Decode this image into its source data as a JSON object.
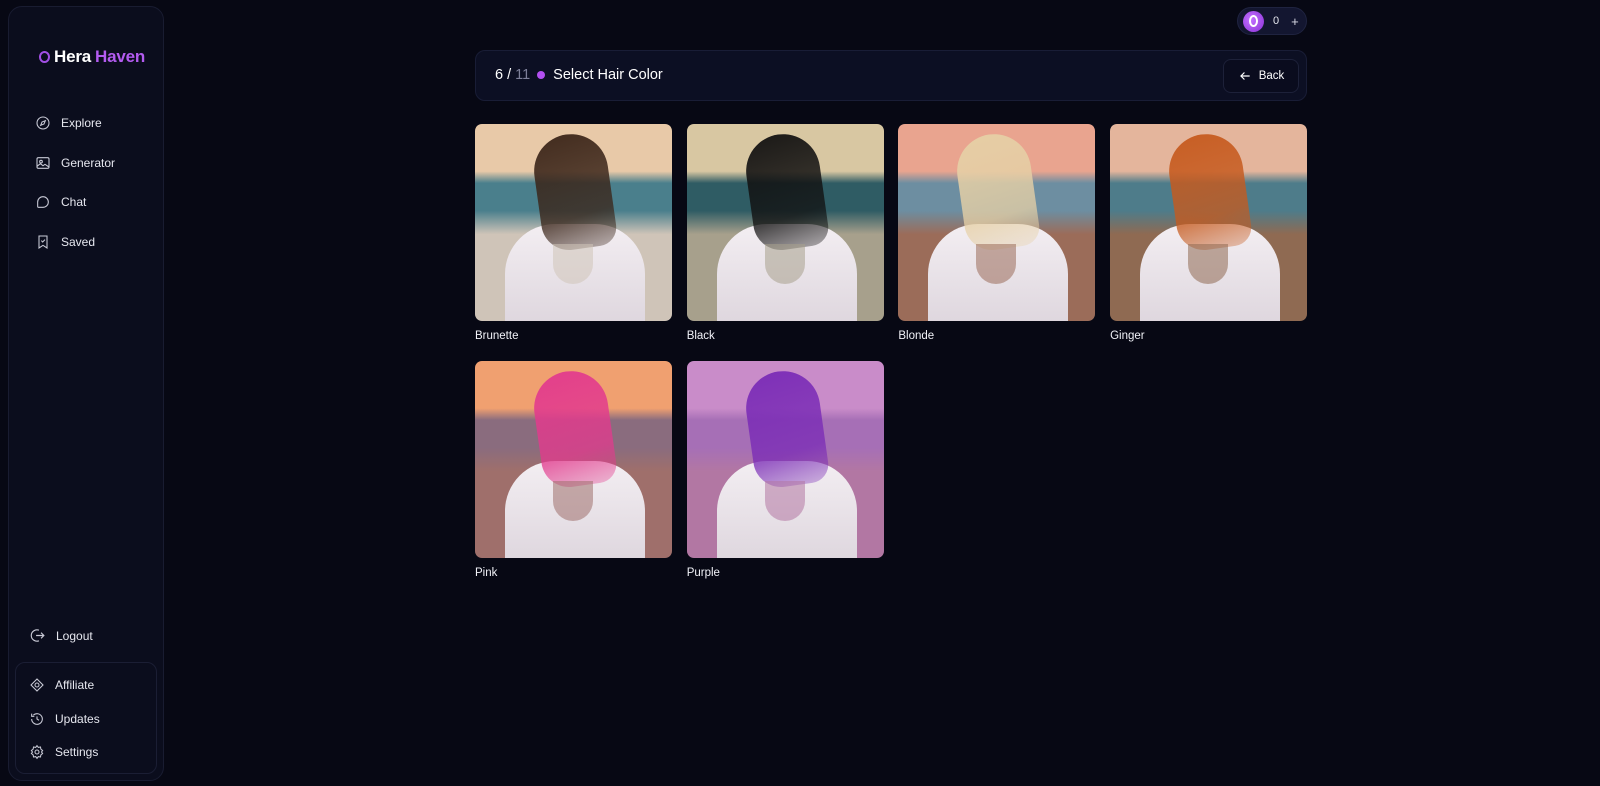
{
  "brand": {
    "part1": "Hera",
    "part2": "Haven"
  },
  "nav": [
    {
      "label": "Explore",
      "icon": "compass-icon"
    },
    {
      "label": "Generator",
      "icon": "image-generator-icon"
    },
    {
      "label": "Chat",
      "icon": "chat-bubble-icon"
    },
    {
      "label": "Saved",
      "icon": "bookmark-icon"
    }
  ],
  "logout": {
    "label": "Logout",
    "icon": "logout-icon"
  },
  "bottom_nav": [
    {
      "label": "Affiliate",
      "icon": "affiliate-icon"
    },
    {
      "label": "Updates",
      "icon": "history-icon"
    },
    {
      "label": "Settings",
      "icon": "gear-icon"
    }
  ],
  "credits": {
    "count": "0",
    "plus": "+"
  },
  "step": {
    "current": "6",
    "separator": "/",
    "total": "11",
    "title": "Select Hair Color"
  },
  "back_label": "Back",
  "options": [
    {
      "label": "Brunette",
      "hair": "#3a2418",
      "sky": "#e8c9a8",
      "sea": "#4a7f8c",
      "sand": "#cfc4b8"
    },
    {
      "label": "Black",
      "hair": "#111010",
      "sky": "#d8c7a2",
      "sea": "#2f5c64",
      "sand": "#a7a08c"
    },
    {
      "label": "Blonde",
      "hair": "#e6d0a6",
      "sky": "#e9a48f",
      "sea": "#6d8ea1",
      "sand": "#9b6c59"
    },
    {
      "label": "Ginger",
      "hair": "#c65a1e",
      "sky": "#e4b59c",
      "sea": "#4e7c8a",
      "sand": "#8f6a52"
    },
    {
      "label": "Pink",
      "hair": "#e23a8d",
      "sky": "#f0a070",
      "sea": "#8a6c7e",
      "sand": "#9f6f6b"
    },
    {
      "label": "Purple",
      "hair": "#7a2bb6",
      "sky": "#c98cc9",
      "sea": "#a66fb6",
      "sand": "#b277a3"
    }
  ]
}
